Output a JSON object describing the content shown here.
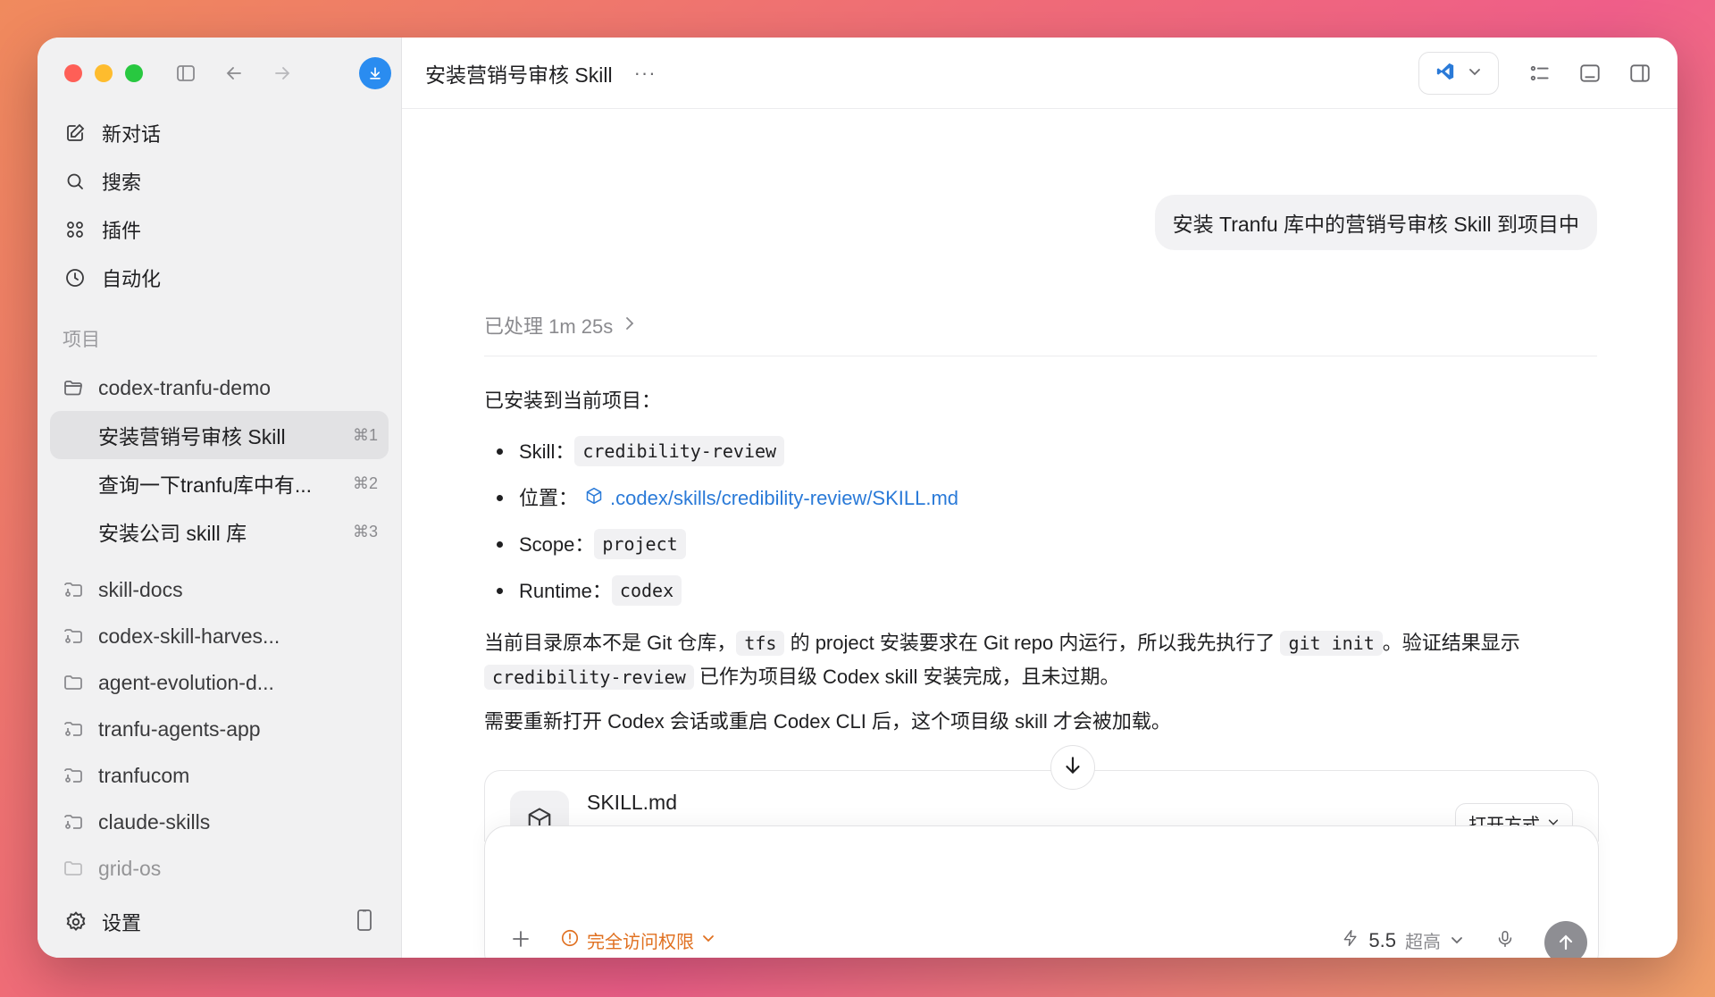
{
  "sidebar": {
    "nav": [
      {
        "label": "新对话",
        "icon": "compose-icon"
      },
      {
        "label": "搜索",
        "icon": "search-icon"
      },
      {
        "label": "插件",
        "icon": "plugins-icon"
      },
      {
        "label": "自动化",
        "icon": "clock-icon"
      }
    ],
    "section_label": "项目",
    "current_project": "codex-tranfu-demo",
    "threads": [
      {
        "label": "安装营销号审核 Skill",
        "shortcut": "⌘1"
      },
      {
        "label": "查询一下tranfu库中有...",
        "shortcut": "⌘2"
      },
      {
        "label": "安装公司 skill 库",
        "shortcut": "⌘3"
      }
    ],
    "projects": [
      "skill-docs",
      "codex-skill-harves...",
      "agent-evolution-d...",
      "tranfu-agents-app",
      "tranfucom",
      "claude-skills",
      "grid-os"
    ],
    "settings_label": "设置"
  },
  "header": {
    "title": "安装营销号审核 Skill",
    "more": "···"
  },
  "chat": {
    "user_message": "安装 Tranfu 库中的营销号审核 Skill 到项目中",
    "processed": "已处理 1m 25s",
    "lead": "已安装到当前项目：",
    "items": [
      {
        "key": "Skill：",
        "value": "credibility-review"
      },
      {
        "key": "位置：",
        "value": ".codex/skills/credibility-review/SKILL.md"
      },
      {
        "key": "Scope：",
        "value": "project"
      },
      {
        "key": "Runtime：",
        "value": "codex"
      }
    ],
    "para2": {
      "t1": "当前目录原本不是 Git 仓库，",
      "c1": "tfs",
      "t2": " 的 project 安装要求在 Git repo 内运行，所以我先执行了 ",
      "c2": "git init",
      "t3": "。验证结果显示",
      "c3": "credibility-review",
      "t4": " 已作为项目级 Codex skill 安装完成，且未过期。"
    },
    "para3": "需要重新打开 Codex 会话或重启 Codex CLI 后，这个项目级 skill 才会被加载。",
    "file_card": {
      "name": "SKILL.md",
      "open_with": "打开方式"
    }
  },
  "composer": {
    "access": "完全访问权限",
    "model": "5.5",
    "level": "超高"
  },
  "colors": {
    "accent": "#2a8cf0",
    "link": "#2a7ad8",
    "warning": "#e07020"
  }
}
